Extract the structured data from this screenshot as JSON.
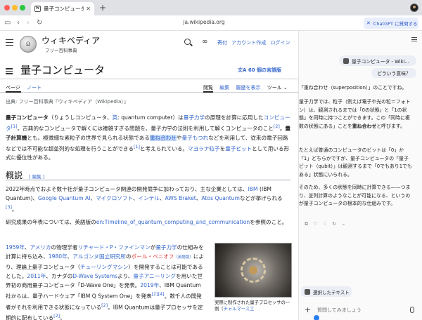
{
  "browser": {
    "tab_title": "量子コンピュータ - Wiki",
    "tab_favicon": "W",
    "url": "ja.wikipedia.org",
    "chatgpt_button": "ChatGPT に質問する"
  },
  "wiki": {
    "logo_letter": "Ω",
    "site_name": "ウィキペディア",
    "tagline": "フリー百科事典",
    "header_links": [
      "寄付",
      "アカウント作成",
      "ログイン"
    ],
    "title": "量子コンピュータ",
    "lang_button": "60 個の言語版",
    "tabs_left": [
      "ページ",
      "ノート"
    ],
    "tabs_right": [
      "閲覧",
      "編集",
      "履歴を表示",
      "ツール ⌄"
    ],
    "source": "出典: フリー百科事典『ウィキペディア（Wikipedia）』",
    "p1": {
      "a": "量子コンピュータ",
      "b": "（りょうしコンピュータ、",
      "c": "英",
      "d": ": quantum computer）は",
      "e": "量子力学",
      "f": "の原理を計算に応用した",
      "g": "コンピュータ",
      "h": "[1]",
      "i": "。古典的なコンピュータで解くには複雑すぎる問題を、量子力学の法則を利用して解くコンピュータのこと",
      "j": "[2]",
      "k": "。",
      "l": "量子計算機",
      "m": "とも。極微細な素粒子の世界で見られる状態である",
      "n": "重ね合わせ",
      "o": "や",
      "p": "量子もつれ",
      "q": "などを利用して、従来の電子回路などでは不可能な超並列的な処理を行うことができる",
      "r": "[1]",
      "s": "と考えられている。",
      "t": "マヨラナ粒子",
      "u": "を",
      "v": "量子ビット",
      "w": "として用いる形式に優位性がある。"
    },
    "section_title": "概説",
    "section_edit": "[ 編集 ]",
    "p2": {
      "a": "2022年時点でおよそ数十社が量子コンピュータ関連の開発競争に加わっており、主な企業としては、",
      "b": "IBM",
      "c": " (IBM Quantum)、",
      "d": "Google Quantum AI",
      "e": "、",
      "f": "マイクロソフト",
      "g": "、",
      "h": "インテル",
      "i": "、",
      "j": "AWS Braket",
      "k": "、",
      "l": "Atos Quantum",
      "m": "などが挙げられる",
      "n": "[3]",
      "o": "。"
    },
    "p3": {
      "a": "研究成果の年表については、英語版の",
      "b": "en:Timeline_of_quantum_computing_and_communication",
      "c": "を参照のこと。"
    },
    "p4": {
      "a": "1959年",
      "b": "、",
      "c": "アメリカ",
      "d": "の物理学者",
      "e": "リチャード・P・ファインマン",
      "f": "が",
      "g": "量子力学",
      "h": "の仕組みを計算に持ち込み、",
      "i": "1980年",
      "j": "、",
      "k": "アルゴンヌ国立研究所",
      "l": "の",
      "m": "ポール・ベニオフ",
      "n": "（英語版）",
      "o": "により、理論上量子コンピュータ（",
      "p": "チューリングマシン",
      "q": "）を開発することは可能であるとした。",
      "r": "2011年",
      "s": "、カナダの",
      "t": "D-Wave Systems",
      "u": "より、",
      "v": "量子アニーリング",
      "w": "を用いた世界初の商用量子コンピュータ「D-Wave One」を発表。",
      "x": "2019年",
      "y": "、IBM Quantum社からは、量子ハードウェア「IBM Q System One」を発表",
      "z": "[2][4]",
      "aa": "。数千人の開発者がそれを利用できる状態になっている",
      "ab": "[2]",
      "ac": "。IBM Quantumは量子プロセッサを定期的に配布している",
      "ad": "[2]",
      "ae": "。"
    },
    "figure_caption_a": "実際に制作された量子プロセッサの一例（",
    "figure_caption_b": "チャルマース工"
  },
  "chat": {
    "context_chip": "量子コンピュータ - Wiki...",
    "user_q": "どういう意味？",
    "a1": "「重ね合わせ（superposition）」のことですね。",
    "a2a": "量子力学では、粒子（例えば電子や光の粒＝フォトン）は、観測されるまでは「0の状態」と「1の状態」を同時に持つことができます。この「同時に複数の状態にある」ことを",
    "a2b": "重ね合わせ",
    "a2c": "と呼びます。",
    "a3a": "たとえば普通のコンピュータのビットは「0」か「1」どちらかですが、量子コンピュータの「量子ビット（qubit）」は観測するまで「0でもあり1でもある」状態にいられる。",
    "a4": "そのため、多くの状態を同時に計算できる——つまり、並列計算のようなことが可能になる、というのが量子コンピュータの根本的な仕組みです。",
    "reactions": [
      "⧉",
      "♡",
      "♢",
      "↻",
      "⌄"
    ],
    "selected_text_chip": "選択したテキスト",
    "input_placeholder": "質問してみましょう"
  }
}
